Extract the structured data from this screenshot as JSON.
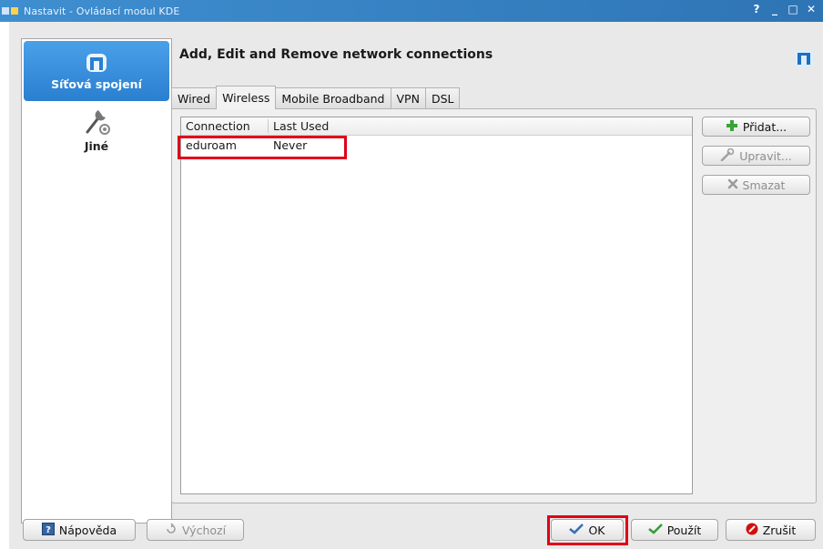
{
  "window": {
    "title": "Nastavit - Ovládací modul KDE",
    "controls": [
      "?",
      "_",
      "□",
      "✕"
    ]
  },
  "sidebar": {
    "items": [
      {
        "label": "Síťová spojení",
        "icon": "network-manager-icon",
        "active": true
      },
      {
        "label": "Jiné",
        "icon": "tools-wrench-gear-icon",
        "active": false
      }
    ]
  },
  "main": {
    "heading": "Add, Edit and Remove network connections",
    "tabs": [
      {
        "label": "Wired",
        "active": false
      },
      {
        "label": "Wireless",
        "active": true
      },
      {
        "label": "Mobile Broadband",
        "active": false
      },
      {
        "label": "VPN",
        "active": false
      },
      {
        "label": "DSL",
        "active": false
      }
    ],
    "list": {
      "columns": [
        "Connection",
        "Last Used"
      ],
      "rows": [
        {
          "connection": "eduroam",
          "last_used": "Never"
        }
      ]
    },
    "actions": {
      "add": "Přidat...",
      "edit": "Upravit...",
      "delete": "Smazat"
    }
  },
  "footer": {
    "help": "Nápověda",
    "defaults": "Výchozí",
    "ok": "OK",
    "apply": "Použít",
    "cancel": "Zrušit"
  },
  "colors": {
    "accent": "#2a7fd0",
    "highlight_annotation": "#e0001a",
    "add_icon": "#3aa33a",
    "ok_check": "#3a6fb5",
    "cancel_icon": "#d01010"
  }
}
